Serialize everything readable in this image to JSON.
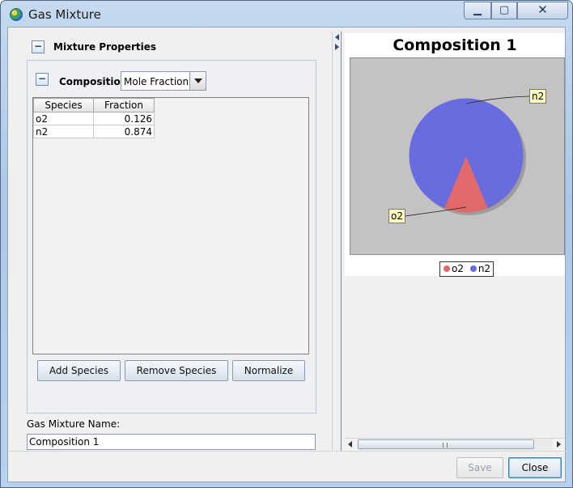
{
  "window": {
    "title": "Gas Mixture",
    "controls": {
      "minimize": "▁",
      "maximize": "▢",
      "close": "✕"
    }
  },
  "mixture_properties": {
    "label": "Mixture Properties",
    "collapse_glyph": "−"
  },
  "composition": {
    "label": "Composition",
    "collapse_glyph": "−",
    "mode_selected": "Mole Fraction",
    "table": {
      "columns": [
        "Species",
        "Fraction"
      ],
      "rows": [
        {
          "species": "o2",
          "fraction": "0.126"
        },
        {
          "species": "n2",
          "fraction": "0.874"
        }
      ]
    },
    "buttons": {
      "add": "Add Species",
      "remove": "Remove Species",
      "normalize": "Normalize"
    }
  },
  "mixture_name": {
    "label": "Gas Mixture Name:",
    "value": "Composition 1"
  },
  "chart_data": {
    "type": "pie",
    "title": "Composition 1",
    "labels": [
      "o2",
      "n2"
    ],
    "values": [
      0.126,
      0.874
    ],
    "colors": [
      "#e06a6a",
      "#6b6be0"
    ],
    "legend": "bottom",
    "slice_labels": "callouts"
  },
  "footer": {
    "save": "Save",
    "close": "Close"
  },
  "colors": {
    "plot_background": "#c3c3c3",
    "callout_background": "#fffec0"
  },
  "scroll": {
    "grip": "|||"
  }
}
